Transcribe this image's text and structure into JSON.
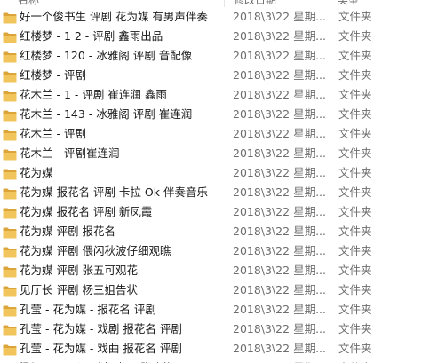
{
  "header": {
    "name_label": "名称",
    "date_label": "修改日期",
    "type_label": "类型"
  },
  "colors": {
    "folder_fill": "#f2c55c",
    "folder_dark": "#dba53a",
    "text": "#1a1a1a",
    "muted_text": "#6d6d6d"
  },
  "icon": "folder-icon",
  "rows": [
    {
      "name": "好一个俊书生 评剧 花为媒 有男声伴奏",
      "date": "2018\\3\\22 星期...",
      "type": "文件夹"
    },
    {
      "name": "红楼梦 - 1 2 - 评剧 鑫雨出品",
      "date": "2018\\3\\22 星期...",
      "type": "文件夹"
    },
    {
      "name": "红楼梦 - 120 - 冰雅阁 评剧 音配像",
      "date": "2018\\3\\22 星期...",
      "type": "文件夹"
    },
    {
      "name": "红楼梦 - 评剧",
      "date": "2018\\3\\22 星期...",
      "type": "文件夹"
    },
    {
      "name": "花木兰 - 1 - 评剧 崔连润 鑫雨",
      "date": "2018\\3\\22 星期...",
      "type": "文件夹"
    },
    {
      "name": "花木兰 - 143 - 冰雅阁 评剧 崔连润",
      "date": "2018\\3\\22 星期...",
      "type": "文件夹"
    },
    {
      "name": "花木兰 - 评剧",
      "date": "2018\\3\\22 星期...",
      "type": "文件夹"
    },
    {
      "name": "花木兰 - 评剧崔连润",
      "date": "2018\\3\\22 星期...",
      "type": "文件夹"
    },
    {
      "name": "花为媒",
      "date": "2018\\3\\22 星期...",
      "type": "文件夹"
    },
    {
      "name": "花为媒 报花名 评剧 卡拉 Ok 伴奏音乐",
      "date": "2018\\3\\22 星期...",
      "type": "文件夹"
    },
    {
      "name": "花为媒 报花名 评剧 新凤霞",
      "date": "2018\\3\\22 星期...",
      "type": "文件夹"
    },
    {
      "name": "花为媒 评剧 报花名",
      "date": "2018\\3\\22 星期...",
      "type": "文件夹"
    },
    {
      "name": "花为媒 评剧 偎闪秋波仔细观瞧",
      "date": "2018\\3\\22 星期...",
      "type": "文件夹"
    },
    {
      "name": "花为媒 评剧 张五可观花",
      "date": "2018\\3\\22 星期...",
      "type": "文件夹"
    },
    {
      "name": "见厅长 评剧 杨三姐告状",
      "date": "2018\\3\\22 星期...",
      "type": "文件夹"
    },
    {
      "name": "孔莹 - 花为媒 - 报花名 评剧",
      "date": "2018\\3\\22 星期...",
      "type": "文件夹"
    },
    {
      "name": "孔莹 - 花为媒 - 戏剧 报花名 评剧",
      "date": "2018\\3\\22 星期...",
      "type": "文件夹"
    },
    {
      "name": "孔莹 - 花为媒 - 戏曲 报花名 评剧",
      "date": "2018\\3\\22 星期...",
      "type": "文件夹"
    },
    {
      "name": "梁祝 - 18 - 评剧 忆十八 张晓梅",
      "date": "2018\\3\\22 星期...",
      "type": "文件夹"
    }
  ]
}
